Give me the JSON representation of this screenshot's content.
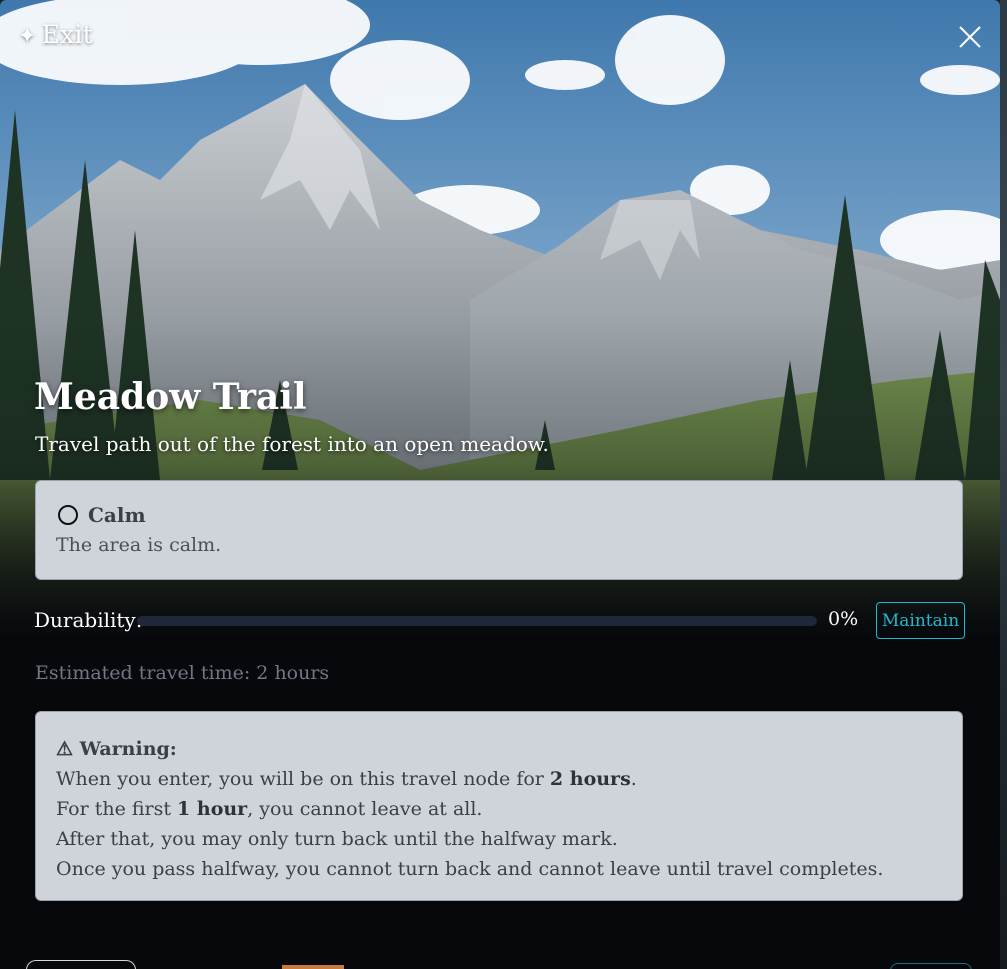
{
  "header": {
    "exit_label": "Exit",
    "exit_icon": "sparkle-icon",
    "close_icon": "close-x-icon"
  },
  "location": {
    "title": "Meadow Trail",
    "description": "Travel path out of the forest into an open meadow."
  },
  "status": {
    "icon": "empty-circle-icon",
    "label": "Calm",
    "description": "The area is calm."
  },
  "durability": {
    "label": "Durability:",
    "percent": 0,
    "percent_text": "0%",
    "maintain_label": "Maintain",
    "accent_color": "#22b8cf"
  },
  "estimate": {
    "text": "Estimated travel time: 2 hours"
  },
  "warning": {
    "icon": "warning-triangle-icon",
    "title": "Warning:",
    "line1": {
      "before": "When you enter, you will be on this travel node for ",
      "bold": "2 hours",
      "after": "."
    },
    "line2": {
      "before": "For the first ",
      "bold": "1 hour",
      "after": ", you cannot leave at all."
    },
    "line3": "After that, you may only turn back until the halfway mark.",
    "line4": "Once you pass halfway, you cannot turn back and cannot leave until travel completes."
  },
  "colors": {
    "panel": "#cfd3da",
    "background": "#06080c",
    "accent": "#22b8cf"
  }
}
